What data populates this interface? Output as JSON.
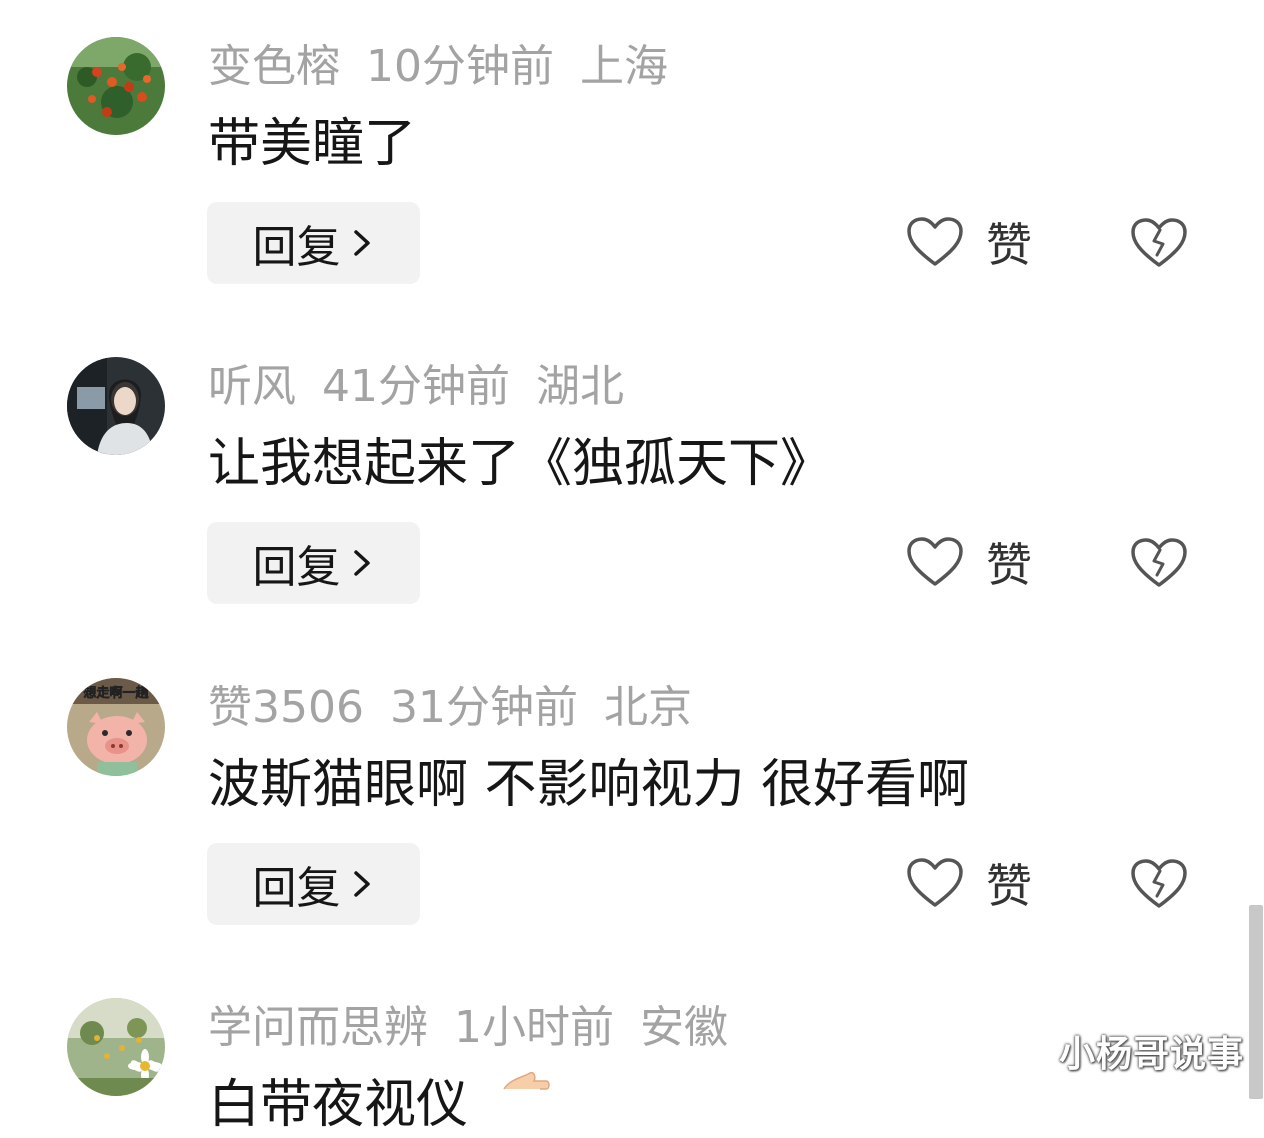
{
  "comments": [
    {
      "username": "变色榕",
      "time": "10分钟前",
      "location": "上海",
      "text": "带美瞳了",
      "reply_label": "回复",
      "like_label": "赞",
      "avatar_icon": "berry-tree-photo"
    },
    {
      "username": "听风",
      "time": "41分钟前",
      "location": "湖北",
      "text": "让我想起来了《独孤天下》",
      "reply_label": "回复",
      "like_label": "赞",
      "avatar_icon": "portrait-photo"
    },
    {
      "username": "赞3506",
      "time": "31分钟前",
      "location": "北京",
      "text": "波斯猫眼啊 不影响视力 很好看啊",
      "reply_label": "回复",
      "like_label": "赞",
      "avatar_icon": "cartoon-pig-photo",
      "avatar_caption": "想走啊一趟"
    },
    {
      "username": "学问而思辨",
      "time": "1小时前",
      "location": "安徽",
      "text": "白带夜视仪",
      "avatar_icon": "daisy-field-photo"
    }
  ],
  "watermark": "小杨哥说事",
  "colors": {
    "meta_text": "#a3a3a3",
    "body_text": "#161616",
    "button_bg": "#f2f2f2",
    "icon_stroke": "#555555"
  }
}
